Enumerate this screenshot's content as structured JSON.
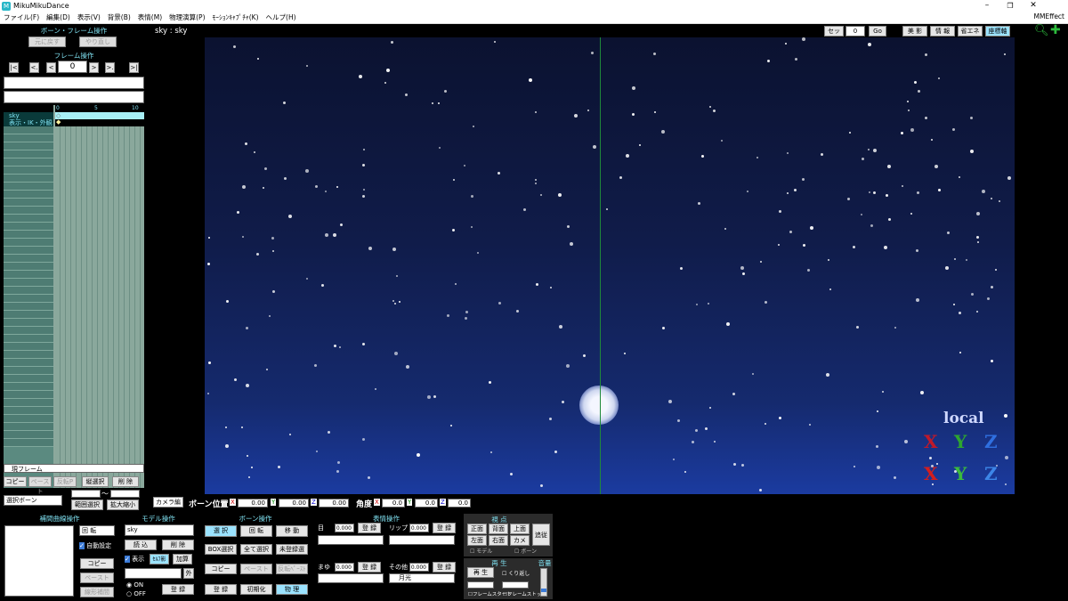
{
  "window": {
    "title": "MikuMikuDance",
    "app_icon": "M"
  },
  "menu": {
    "items": [
      "ファイル(F)",
      "編集(D)",
      "表示(V)",
      "背景(B)",
      "表情(M)",
      "物理演算(P)",
      "ﾓｰｼｮﾝｷｬﾌﾟﾁｬ(K)",
      "ヘルプ(H)"
    ],
    "right": "MMEffect"
  },
  "left": {
    "bone_frame_title": "ボーン・フレーム操作",
    "undo": "元に戻す",
    "redo": "やり直し",
    "frame_title": "フレーム操作",
    "frame_value": "0",
    "nav": [
      "|<",
      "<.",
      "<",
      ">",
      ">.",
      ">|"
    ],
    "ruler": [
      "0",
      "5",
      "10"
    ],
    "tracks": [
      "sky",
      "表示・IK・外観"
    ],
    "current_frame_tab": "現フレーム",
    "copy": "コピー",
    "paste": "ペースト",
    "reverse_paste": "反転P",
    "vertical_select": "縦選択",
    "delete": "削 除",
    "select_bone": "選択ボーン",
    "range_select": "範囲選択",
    "zoom": "拡大縮小",
    "tilde": "～"
  },
  "viewport": {
    "label": "sky : sky",
    "set": "セット",
    "frame_input": "0",
    "go": "Go",
    "toolbar": [
      "美 影",
      "情 報",
      "省エネ",
      "座標軸"
    ],
    "local_label": "local",
    "gizmo_top": [
      "X",
      "Y",
      "Z"
    ],
    "gizmo_bottom": [
      "X",
      "Y",
      "Z"
    ]
  },
  "bone_pos": {
    "camera_tab": "カメラ編",
    "pos_label": "ボーン位置",
    "x": "0.00",
    "y": "0.00",
    "z": "0.00",
    "angle_label": "角度",
    "ax": "0.0",
    "ay": "0.0",
    "az": "0.0"
  },
  "interp": {
    "title": "補間曲線操作",
    "rotate": "回 転",
    "auto": "自動設定",
    "copy": "コピー",
    "paste": "ペースト",
    "linear": "線形補間"
  },
  "model": {
    "title": "モデル操作",
    "name": "sky",
    "load": "読 込",
    "delete": "削 除",
    "show": "表示",
    "shadow": "ｾﾙﾌ影",
    "add": "加算",
    "outside": "外",
    "on": "ON",
    "off": "OFF",
    "register": "登 録"
  },
  "bone": {
    "title": "ボーン操作",
    "select": "選 択",
    "rotate": "回 転",
    "move": "移 動",
    "box": "BOX選択",
    "all": "全て選択",
    "unregistered": "未登録選",
    "copy": "コピー",
    "paste": "ペースト",
    "reverse": "反転ﾍﾟｰｽﾄ",
    "register": "登 録",
    "init": "初期化",
    "physics": "物 理"
  },
  "morph": {
    "title": "表情操作",
    "eye": "目",
    "eye_v": "0.000",
    "lip": "リップ",
    "lip_v": "0.000",
    "brow": "まゆ",
    "brow_v": "0.000",
    "other": "その他",
    "other_v": "0.000",
    "register": "登 録",
    "other_sel": "月光"
  },
  "view": {
    "title": "視 点",
    "front": "正面",
    "back": "背面",
    "top": "上面",
    "left": "左面",
    "right": "右面",
    "camera": "カメラ",
    "follow": "追従",
    "model": "モデル",
    "bone": "ボーン"
  },
  "play": {
    "title": "再 生",
    "play": "再 生",
    "repeat": "くり返し",
    "frame_start": "フレームスタート",
    "frame_stop": "フレームストップ",
    "volume": "音量"
  }
}
